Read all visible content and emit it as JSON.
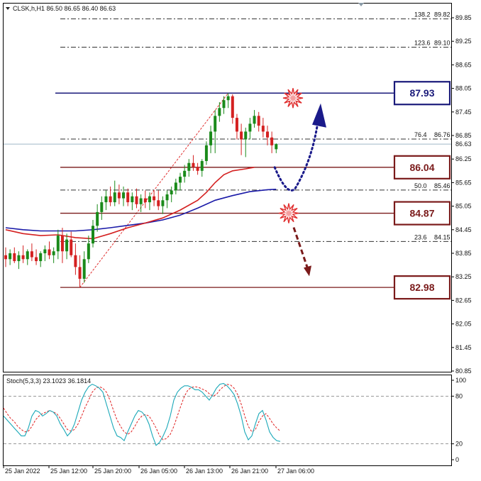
{
  "header": {
    "main_label": "CLSK,h,H1  86.50 86.65 86.40 86.63",
    "stoch_label": "Stoch(5,3,3) 23.1023 36.1814"
  },
  "colors": {
    "bull": "#1a8a1a",
    "bear": "#d42020",
    "ma_fast": "#d42020",
    "ma_slow": "#1a1aa8",
    "resistance_box": "#1a1a7a",
    "level_box": "#7a1a1a",
    "fib_line": "#333333",
    "stoch_main": "#1aa8b8",
    "stoch_signal": "#e02020"
  },
  "chart_data": [
    {
      "type": "candlestick",
      "symbol": "CLSK",
      "timeframe": "H1",
      "ohlc_last": {
        "open": 86.5,
        "high": 86.65,
        "low": 86.4,
        "close": 86.63
      },
      "current_price": 86.63,
      "ylim": [
        80.75,
        90.1
      ],
      "yticks": [
        80.85,
        81.45,
        82.05,
        82.65,
        83.25,
        83.85,
        84.45,
        85.05,
        85.65,
        86.25,
        86.85,
        87.45,
        88.05,
        88.65,
        89.25,
        89.85
      ],
      "xticks": [
        "25 Jan 2022",
        "25 Jan 12:00",
        "25 Jan 20:00",
        "26 Jan 05:00",
        "26 Jan 13:00",
        "26 Jan 21:00",
        "27 Jan 06:00"
      ],
      "candles": [
        [
          83.8,
          84.0,
          83.5,
          83.7
        ],
        [
          83.7,
          83.95,
          83.55,
          83.85
        ],
        [
          83.85,
          84.0,
          83.6,
          83.65
        ],
        [
          83.65,
          83.9,
          83.45,
          83.8
        ],
        [
          83.8,
          84.05,
          83.6,
          83.7
        ],
        [
          83.7,
          83.95,
          83.55,
          83.9
        ],
        [
          83.9,
          84.1,
          83.65,
          83.75
        ],
        [
          83.75,
          83.95,
          83.55,
          83.65
        ],
        [
          83.65,
          83.9,
          83.5,
          83.85
        ],
        [
          83.85,
          84.05,
          83.65,
          83.95
        ],
        [
          83.95,
          84.15,
          83.7,
          83.8
        ],
        [
          83.8,
          84.0,
          83.6,
          83.9
        ],
        [
          83.9,
          84.45,
          83.7,
          84.3
        ],
        [
          84.3,
          84.5,
          83.6,
          83.9
        ],
        [
          83.9,
          84.35,
          83.7,
          84.2
        ],
        [
          84.2,
          84.4,
          83.75,
          83.8
        ],
        [
          83.8,
          84.1,
          83.3,
          83.5
        ],
        [
          83.5,
          83.8,
          82.98,
          83.2
        ],
        [
          83.2,
          83.9,
          83.1,
          83.7
        ],
        [
          83.7,
          84.3,
          83.6,
          84.1
        ],
        [
          84.1,
          84.7,
          84.0,
          84.55
        ],
        [
          84.55,
          85.1,
          84.4,
          84.9
        ],
        [
          84.9,
          85.3,
          84.7,
          85.15
        ],
        [
          85.15,
          85.45,
          84.95,
          85.3
        ],
        [
          85.3,
          85.55,
          85.05,
          85.15
        ],
        [
          85.15,
          85.7,
          85.05,
          85.4
        ],
        [
          85.4,
          85.6,
          85.1,
          85.25
        ],
        [
          85.25,
          85.55,
          85.05,
          85.4
        ],
        [
          85.4,
          85.5,
          85.05,
          85.15
        ],
        [
          85.15,
          85.4,
          84.95,
          85.3
        ],
        [
          85.3,
          85.5,
          85.0,
          85.1
        ],
        [
          85.1,
          85.35,
          84.9,
          85.25
        ],
        [
          85.25,
          85.45,
          85.0,
          85.15
        ],
        [
          85.15,
          85.4,
          84.95,
          85.3
        ],
        [
          85.3,
          85.45,
          85.05,
          85.2
        ],
        [
          85.2,
          85.45,
          84.95,
          85.05
        ],
        [
          85.05,
          85.3,
          84.85,
          85.2
        ],
        [
          85.2,
          85.45,
          85.0,
          85.35
        ],
        [
          85.35,
          85.55,
          85.15,
          85.45
        ],
        [
          85.45,
          85.75,
          85.35,
          85.65
        ],
        [
          85.65,
          85.9,
          85.45,
          85.8
        ],
        [
          85.8,
          86.1,
          85.65,
          85.95
        ],
        [
          85.95,
          86.25,
          85.8,
          86.15
        ],
        [
          86.15,
          86.35,
          85.95,
          86.05
        ],
        [
          86.05,
          86.15,
          85.85,
          85.95
        ],
        [
          85.95,
          86.25,
          85.8,
          86.2
        ],
        [
          86.2,
          86.7,
          86.1,
          86.6
        ],
        [
          86.6,
          87.1,
          86.4,
          86.95
        ],
        [
          86.95,
          87.5,
          86.4,
          87.35
        ],
        [
          87.35,
          87.7,
          87.2,
          87.55
        ],
        [
          87.55,
          87.85,
          87.4,
          87.75
        ],
        [
          87.75,
          87.93,
          87.55,
          87.85
        ],
        [
          87.85,
          87.9,
          87.15,
          87.3
        ],
        [
          87.3,
          87.4,
          86.75,
          86.95
        ],
        [
          86.95,
          87.15,
          86.35,
          86.75
        ],
        [
          86.75,
          87.05,
          86.3,
          86.95
        ],
        [
          86.95,
          87.3,
          86.75,
          87.15
        ],
        [
          87.15,
          87.5,
          87.05,
          87.35
        ],
        [
          87.35,
          87.45,
          86.95,
          87.1
        ],
        [
          87.1,
          87.3,
          86.8,
          86.95
        ],
        [
          86.95,
          87.1,
          86.6,
          86.8
        ],
        [
          86.8,
          86.95,
          86.4,
          86.6
        ],
        [
          86.5,
          86.65,
          86.4,
          86.63
        ]
      ],
      "ma_fast": [
        [
          0,
          84.45
        ],
        [
          4,
          84.35
        ],
        [
          8,
          84.3
        ],
        [
          12,
          84.32
        ],
        [
          16,
          84.25
        ],
        [
          20,
          84.22
        ],
        [
          24,
          84.35
        ],
        [
          28,
          84.5
        ],
        [
          32,
          84.62
        ],
        [
          36,
          84.75
        ],
        [
          40,
          84.95
        ],
        [
          44,
          85.2
        ],
        [
          46,
          85.4
        ],
        [
          48,
          85.65
        ],
        [
          50,
          85.85
        ],
        [
          52,
          85.95
        ],
        [
          55,
          86.0
        ],
        [
          57,
          86.04
        ]
      ],
      "ma_slow": [
        [
          0,
          84.5
        ],
        [
          4,
          84.45
        ],
        [
          8,
          84.42
        ],
        [
          12,
          84.42
        ],
        [
          16,
          84.42
        ],
        [
          20,
          84.45
        ],
        [
          24,
          84.5
        ],
        [
          28,
          84.56
        ],
        [
          32,
          84.62
        ],
        [
          36,
          84.7
        ],
        [
          40,
          84.82
        ],
        [
          44,
          85.0
        ],
        [
          48,
          85.2
        ],
        [
          52,
          85.32
        ],
        [
          56,
          85.42
        ],
        [
          60,
          85.47
        ],
        [
          62,
          85.48
        ]
      ],
      "fibonacci": [
        {
          "label": "138.2",
          "value": 89.82
        },
        {
          "label": "123.6",
          "value": 89.1
        },
        {
          "label": "76.4",
          "value": 86.76
        },
        {
          "label": "50.0",
          "value": 85.46
        },
        {
          "label": "23.6",
          "value": 84.15
        }
      ],
      "levels": [
        {
          "value": 87.93,
          "label": "87.93",
          "role": "resistance"
        },
        {
          "value": 86.04,
          "label": "86.04",
          "role": "support"
        },
        {
          "value": 84.87,
          "label": "84.87",
          "role": "support"
        },
        {
          "value": 82.98,
          "label": "82.98",
          "role": "support"
        }
      ],
      "scenarios": [
        {
          "direction": "up",
          "path": [
            86.04,
            85.5,
            87.45
          ]
        },
        {
          "direction": "down",
          "path": [
            84.87,
            83.3
          ]
        }
      ]
    },
    {
      "type": "line",
      "name": "Stoch(5,3,3)",
      "ylim": [
        0,
        100
      ],
      "yticks": [
        0,
        20,
        80,
        100
      ],
      "main": [
        55,
        50,
        45,
        40,
        35,
        30,
        30,
        40,
        55,
        62,
        60,
        55,
        58,
        62,
        60,
        55,
        45,
        38,
        30,
        35,
        45,
        60,
        75,
        85,
        92,
        95,
        93,
        90,
        85,
        70,
        55,
        40,
        30,
        28,
        24,
        35,
        45,
        55,
        62,
        60,
        55,
        45,
        30,
        18,
        22,
        30,
        40,
        55,
        75,
        85,
        90,
        93,
        93,
        91,
        88,
        88,
        85,
        80,
        75,
        82,
        90,
        95,
        96,
        93,
        88,
        82,
        70,
        55,
        35,
        25,
        30,
        45,
        58,
        62,
        50,
        35,
        28,
        24,
        23
      ],
      "signal": [
        65,
        58,
        52,
        48,
        42,
        38,
        35,
        36,
        42,
        50,
        55,
        58,
        60,
        62,
        60,
        58,
        52,
        45,
        38,
        36,
        38,
        45,
        55,
        66,
        75,
        85,
        90,
        92,
        90,
        85,
        75,
        62,
        50,
        42,
        35,
        32,
        35,
        42,
        50,
        55,
        57,
        55,
        48,
        40,
        30,
        25,
        27,
        32,
        42,
        55,
        68,
        80,
        88,
        91,
        92,
        91,
        89,
        87,
        83,
        80,
        82,
        88,
        92,
        95,
        94,
        90,
        82,
        70,
        55,
        42,
        35,
        38,
        48,
        55,
        58,
        52,
        45,
        40,
        36
      ]
    }
  ]
}
